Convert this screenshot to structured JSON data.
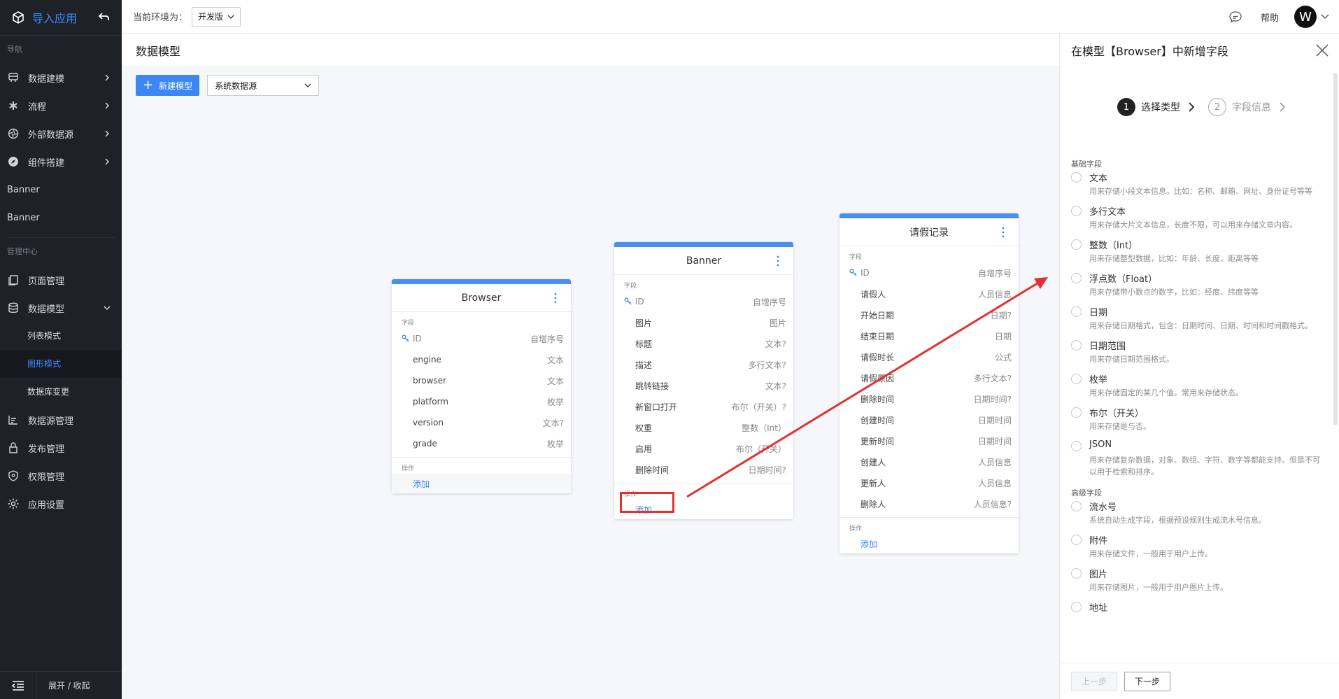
{
  "app": {
    "title": "导入应用"
  },
  "sidebar": {
    "nav_section": "导航",
    "nav_items": [
      {
        "label": "数据建模"
      },
      {
        "label": "流程"
      },
      {
        "label": "外部数据源"
      },
      {
        "label": "组件搭建"
      }
    ],
    "plain_items": [
      {
        "label": "Banner"
      },
      {
        "label": "Banner"
      }
    ],
    "manage_section": "管理中心",
    "manage_items": [
      {
        "label": "页面管理"
      },
      {
        "label": "数据模型"
      }
    ],
    "sub_items": [
      {
        "label": "列表模式"
      },
      {
        "label": "图形模式"
      },
      {
        "label": "数据库变更"
      }
    ],
    "bottom_items": [
      {
        "label": "数据源管理"
      },
      {
        "label": "发布管理"
      },
      {
        "label": "权限管理"
      },
      {
        "label": "应用设置"
      }
    ],
    "footer": "展开 / 收起"
  },
  "topbar": {
    "env_label": "当前环境为：",
    "env_value": "开发版",
    "help": "帮助",
    "avatar": "W"
  },
  "page": {
    "title": "数据模型",
    "new_model": "新建模型",
    "datasource": "系统数据源"
  },
  "models": [
    {
      "name": "Browser",
      "fields_label": "字段",
      "fields": [
        {
          "name": "ID",
          "type": "自增序号"
        },
        {
          "name": "engine",
          "type": "文本"
        },
        {
          "name": "browser",
          "type": "文本"
        },
        {
          "name": "platform",
          "type": "枚举"
        },
        {
          "name": "version",
          "type": "文本?"
        },
        {
          "name": "grade",
          "type": "枚举"
        }
      ],
      "ops_label": "操作",
      "add": "添加"
    },
    {
      "name": "Banner",
      "fields_label": "字段",
      "fields": [
        {
          "name": "ID",
          "type": "自增序号"
        },
        {
          "name": "图片",
          "type": "图片"
        },
        {
          "name": "标题",
          "type": "文本?"
        },
        {
          "name": "描述",
          "type": "多行文本?"
        },
        {
          "name": "跳转链接",
          "type": "文本?"
        },
        {
          "name": "新窗口打开",
          "type": "布尔（开关）?"
        },
        {
          "name": "权重",
          "type": "整数（Int）"
        },
        {
          "name": "启用",
          "type": "布尔（开关）"
        },
        {
          "name": "删除时间",
          "type": "日期时间?"
        }
      ],
      "ops_label": "操作",
      "add": "添加"
    },
    {
      "name": "请假记录",
      "fields_label": "字段",
      "fields": [
        {
          "name": "ID",
          "type": "自增序号"
        },
        {
          "name": "请假人",
          "type": "人员信息"
        },
        {
          "name": "开始日期",
          "type": "日期?"
        },
        {
          "name": "结束日期",
          "type": "日期"
        },
        {
          "name": "请假时长",
          "type": "公式"
        },
        {
          "name": "请假原因",
          "type": "多行文本?"
        },
        {
          "name": "删除时间",
          "type": "日期时间?"
        },
        {
          "name": "创建时间",
          "type": "日期时间"
        },
        {
          "name": "更新时间",
          "type": "日期时间"
        },
        {
          "name": "创建人",
          "type": "人员信息"
        },
        {
          "name": "更新人",
          "type": "人员信息"
        },
        {
          "name": "删除人",
          "type": "人员信息?"
        }
      ],
      "ops_label": "操作",
      "add": "添加"
    }
  ],
  "drawer": {
    "title": "在模型【Browser】中新增字段",
    "steps": [
      {
        "num": "1",
        "label": "选择类型"
      },
      {
        "num": "2",
        "label": "字段信息"
      }
    ],
    "basic_group": "基础字段",
    "basic_types": [
      {
        "name": "文本",
        "desc": "用来存储小段文本信息。比如：名称、邮箱、网址、身份证号等等"
      },
      {
        "name": "多行文本",
        "desc": "用来存储大片文本信息，长度不限，可以用来存储文章内容。"
      },
      {
        "name": "整数（Int）",
        "desc": "用来存储整型数据，比如：年龄、长度、距离等等"
      },
      {
        "name": "浮点数（Float）",
        "desc": "用来存储带小数点的数字，比如：经度、纬度等等"
      },
      {
        "name": "日期",
        "desc": "用来存储日期格式，包含：日期时间、日期、时间和时间戳格式。"
      },
      {
        "name": "日期范围",
        "desc": "用来存储日期范围格式。"
      },
      {
        "name": "枚举",
        "desc": "用来存储固定的某几个值。常用来存储状态。"
      },
      {
        "name": "布尔（开关）",
        "desc": "用来存储是与否。"
      },
      {
        "name": "JSON",
        "desc": "用来存储复杂数据，对象、数组、字符、数字等都能支持。但是不可以用于检索和排序。"
      }
    ],
    "advanced_group": "高级字段",
    "advanced_types": [
      {
        "name": "流水号",
        "desc": "系统自动生成字段，根据预设规则生成流水号信息。"
      },
      {
        "name": "附件",
        "desc": "用来存储文件，一般用于用户上传。"
      },
      {
        "name": "图片",
        "desc": "用来存储图片，一般用于用户图片上传。"
      },
      {
        "name": "地址",
        "desc": ""
      }
    ],
    "prev": "上一步",
    "next": "下一步"
  },
  "colors": {
    "accent": "#3d87f5",
    "sidebar_bg": "#1f2129",
    "highlight": "#e53030"
  }
}
